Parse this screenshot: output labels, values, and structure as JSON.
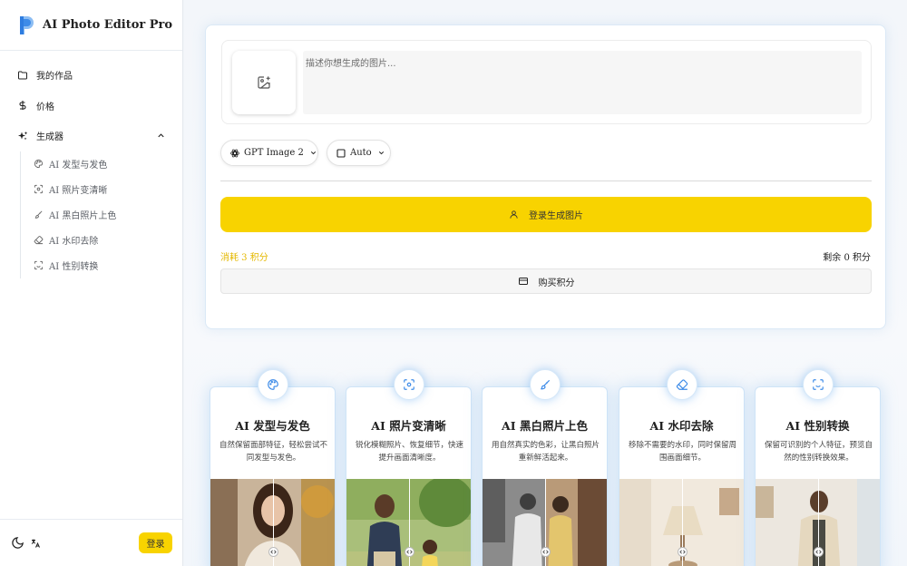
{
  "app": {
    "title": "AI Photo Editor Pro",
    "accent": "#f8d300",
    "logo_color": "#3d8be8"
  },
  "sidebar": {
    "items": [
      {
        "label": "我的作品",
        "icon": "folder-icon"
      },
      {
        "label": "价格",
        "icon": "dollar-icon"
      },
      {
        "label": "生成器",
        "icon": "sparkles-icon",
        "expanded": true
      }
    ],
    "sub_items": [
      {
        "label": "AI 发型与发色",
        "icon": "palette-icon"
      },
      {
        "label": "AI 照片变清晰",
        "icon": "scan-focus-icon"
      },
      {
        "label": "AI 黑白照片上色",
        "icon": "brush-icon"
      },
      {
        "label": "AI 水印去除",
        "icon": "eraser-icon"
      },
      {
        "label": "AI 性别转换",
        "icon": "face-scan-icon"
      }
    ],
    "footer": {
      "login_label": "登录"
    }
  },
  "generator": {
    "prompt_placeholder": "描述你想生成的图片...",
    "model_label": "GPT Image 2",
    "ratio_label": "Auto",
    "generate_label": "登录生成图片",
    "cost_text": "消耗 3 积分",
    "remaining_text": "剩余 0 积分",
    "buy_label": "购买积分"
  },
  "features": [
    {
      "title": "AI 发型与发色",
      "desc": "自然保留面部特征，轻松尝试不同发型与发色。",
      "icon": "palette-icon"
    },
    {
      "title": "AI 照片变清晰",
      "desc": "锐化模糊照片、恢复细节，快速提升画面清晰度。",
      "icon": "scan-focus-icon"
    },
    {
      "title": "AI 黑白照片上色",
      "desc": "用自然真实的色彩，让黑白照片重新鲜活起来。",
      "icon": "brush-icon"
    },
    {
      "title": "AI 水印去除",
      "desc": "移除不需要的水印，同时保留周围画面细节。",
      "icon": "eraser-icon"
    },
    {
      "title": "AI 性别转换",
      "desc": "保留可识别的个人特征，预览自然的性别转换效果。",
      "icon": "face-scan-icon"
    }
  ]
}
